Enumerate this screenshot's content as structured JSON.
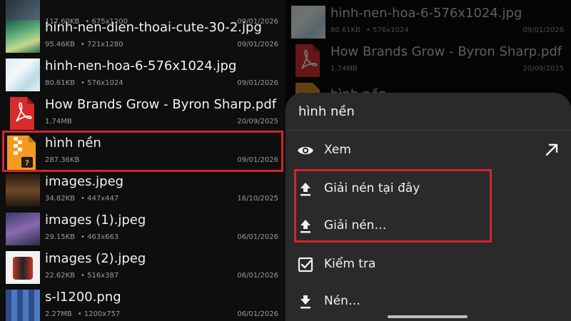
{
  "files": [
    {
      "name": "",
      "size": "117.60KB",
      "dims": "675x1200",
      "date": "09/01/2026",
      "thumb": "dark"
    },
    {
      "name": "hinh-nen-dien-thoai-cute-30-2.jpg",
      "size": "95.46KB",
      "dims": "721x1280",
      "date": "09/01/2026",
      "thumb": "green"
    },
    {
      "name": "hinh-nen-hoa-6-576x1024.jpg",
      "size": "80.61KB",
      "dims": "576x1024",
      "date": "09/01/2026",
      "thumb": "pale"
    },
    {
      "name": "How Brands Grow - Byron Sharp.pdf",
      "size": "1.74MB",
      "dims": "",
      "date": "20/09/2025",
      "thumb": "pdf"
    },
    {
      "name": "hình nền",
      "size": "287.36KB",
      "dims": "",
      "date": "09/01/2026",
      "thumb": "zip"
    },
    {
      "name": "images.jpeg",
      "size": "34.82KB",
      "dims": "447x447",
      "date": "16/10/2025",
      "thumb": "potter"
    },
    {
      "name": "images (1).jpeg",
      "size": "29.15KB",
      "dims": "463x663",
      "date": "06/01/2026",
      "thumb": "funko"
    },
    {
      "name": "images (2).jpeg",
      "size": "22.62KB",
      "dims": "516x387",
      "date": "06/01/2026",
      "thumb": "key"
    },
    {
      "name": "s-l1200.png",
      "size": "2.27MB",
      "dims": "1200x757",
      "date": "06/01/2026",
      "thumb": "png"
    }
  ],
  "background_files": [
    {
      "name": "hinh-nen-hoa-6-576x1024.jpg",
      "size": "80.61KB",
      "dims": "576x1024",
      "date": "09/01/2026"
    },
    {
      "name": "How Brands Grow - Byron Sharp.pdf",
      "size": "1.74MB",
      "dims": "",
      "date": "20/09/2025"
    },
    {
      "name": "hình nền",
      "size": "",
      "dims": "",
      "date": ""
    }
  ],
  "sheet": {
    "title": "hình nền",
    "items": [
      {
        "label": "Xem",
        "icon": "eye-icon"
      },
      {
        "label": "Giải nén tại đây",
        "icon": "extract-icon"
      },
      {
        "label": "Giải nén…",
        "icon": "extract-icon"
      },
      {
        "label": "Kiểm tra",
        "icon": "checkbox-icon"
      },
      {
        "label": "Nén…",
        "icon": "download-icon"
      }
    ]
  },
  "colors": {
    "highlight": "#d3252e",
    "sheet_bg": "#2a2a2a",
    "zip_orange": "#f59a1e",
    "pdf_red": "#d92b2b"
  }
}
